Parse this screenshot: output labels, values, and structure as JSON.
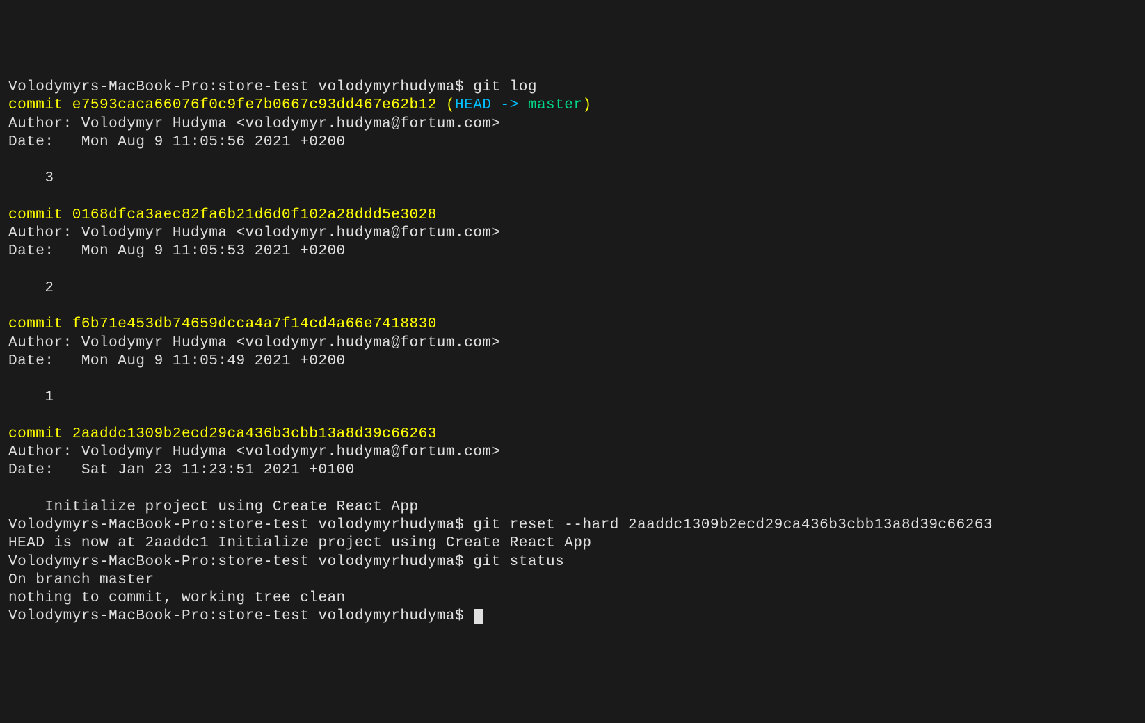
{
  "prompt": "Volodymyrs-MacBook-Pro:store-test volodymyrhudyma$ ",
  "cmd_gitlog": "git log",
  "cmd_gitreset": "git reset --hard 2aaddc1309b2ecd29ca436b3cbb13a8d39c66263",
  "cmd_gitstatus": "git status",
  "commits": [
    {
      "hash_line": "commit e7593caca66076f0c9fe7b0667c93dd467e62b12",
      "ref_open": " (",
      "ref_head": "HEAD -> ",
      "ref_master": "master",
      "ref_close": ")",
      "author": "Author: Volodymyr Hudyma <volodymyr.hudyma@fortum.com>",
      "date": "Date:   Mon Aug 9 11:05:56 2021 +0200",
      "message": "    3",
      "is_head": true
    },
    {
      "hash_line": "commit 0168dfca3aec82fa6b21d6d0f102a28ddd5e3028",
      "author": "Author: Volodymyr Hudyma <volodymyr.hudyma@fortum.com>",
      "date": "Date:   Mon Aug 9 11:05:53 2021 +0200",
      "message": "    2",
      "is_head": false
    },
    {
      "hash_line": "commit f6b71e453db74659dcca4a7f14cd4a66e7418830",
      "author": "Author: Volodymyr Hudyma <volodymyr.hudyma@fortum.com>",
      "date": "Date:   Mon Aug 9 11:05:49 2021 +0200",
      "message": "    1",
      "is_head": false
    },
    {
      "hash_line": "commit 2aaddc1309b2ecd29ca436b3cbb13a8d39c66263",
      "author": "Author: Volodymyr Hudyma <volodymyr.hudyma@fortum.com>",
      "date": "Date:   Sat Jan 23 11:23:51 2021 +0100",
      "message": "    Initialize project using Create React App",
      "is_head": false
    }
  ],
  "reset_output": "HEAD is now at 2aaddc1 Initialize project using Create React App",
  "status_output": {
    "branch": "On branch master",
    "clean": "nothing to commit, working tree clean"
  }
}
